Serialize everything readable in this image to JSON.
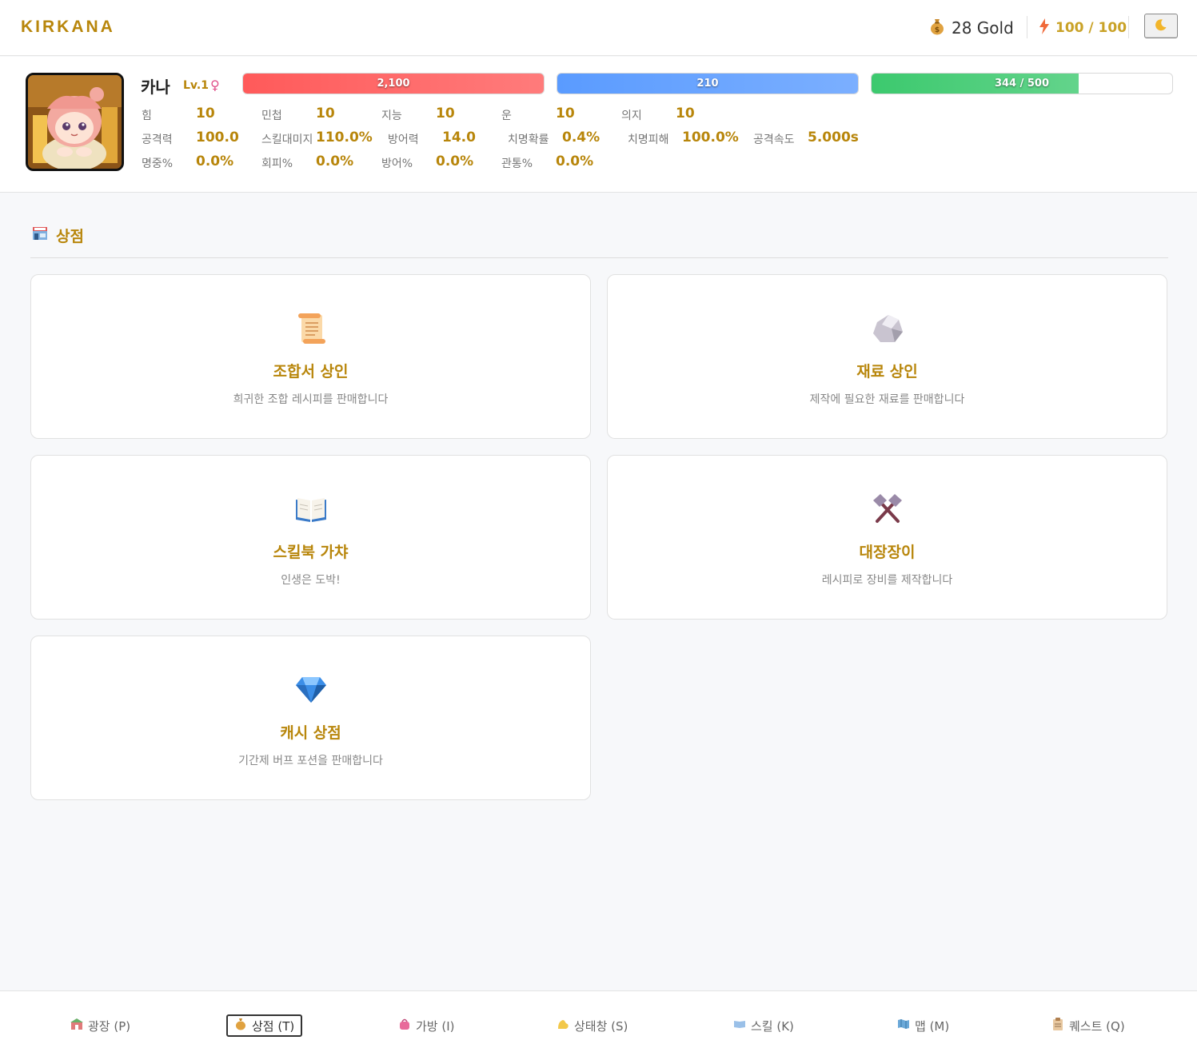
{
  "header": {
    "logo": "KIRKANA",
    "gold_icon": "money-bag-icon",
    "gold_text": "28 Gold",
    "energy_icon": "lightning-icon",
    "energy_text": "100 / 100",
    "theme_icon": "moon-icon"
  },
  "character": {
    "name": "카나",
    "level": "Lv.1",
    "gender": "♀",
    "hp": {
      "label": "2,100",
      "fraction": 1.0,
      "color": "#ff5a5a"
    },
    "mp": {
      "label": "210",
      "fraction": 1.0,
      "color": "#5a9bff"
    },
    "exp": {
      "label": "344 / 500",
      "fraction": 0.688,
      "color": "#3cc96e"
    },
    "stats": [
      [
        {
          "k": "힘",
          "v": "10"
        },
        {
          "k": "민첩",
          "v": "10"
        },
        {
          "k": "지능",
          "v": "10"
        },
        {
          "k": "운",
          "v": "10"
        },
        {
          "k": "의지",
          "v": "10"
        }
      ],
      [
        {
          "k": "공격력",
          "v": "100.0"
        },
        {
          "k": "스킬대미지",
          "v": "110.0%"
        },
        {
          "k": "방어력",
          "v": "14.0"
        },
        {
          "k": "치명확률",
          "v": "0.4%"
        },
        {
          "k": "치명피해",
          "v": "100.0%"
        },
        {
          "k": "공격속도",
          "v": "5.000s"
        }
      ],
      [
        {
          "k": "명중%",
          "v": "0.0%"
        },
        {
          "k": "회피%",
          "v": "0.0%"
        },
        {
          "k": "방어%",
          "v": "0.0%"
        },
        {
          "k": "관통%",
          "v": "0.0%"
        }
      ]
    ]
  },
  "shop": {
    "icon": "store-icon",
    "title": "상점",
    "cards": [
      {
        "icon": "scroll-icon",
        "title": "조합서 상인",
        "desc": "희귀한 조합 레시피를 판매합니다"
      },
      {
        "icon": "rock-icon",
        "title": "재료 상인",
        "desc": "제작에 필요한 재료를 판매합니다"
      },
      {
        "icon": "open-book-icon",
        "title": "스킬북 가챠",
        "desc": "인생은 도박!"
      },
      {
        "icon": "hammers-icon",
        "title": "대장장이",
        "desc": "레시피로 장비를 제작합니다"
      },
      {
        "icon": "gem-icon",
        "title": "캐시 상점",
        "desc": "기간제 버프 포션을 판매합니다"
      }
    ]
  },
  "nav": [
    {
      "icon": "plaza-icon",
      "label": "광장 (P)"
    },
    {
      "icon": "money-bag-icon",
      "label": "상점 (T)",
      "active": true
    },
    {
      "icon": "bag-icon",
      "label": "가방 (I)"
    },
    {
      "icon": "muscle-icon",
      "label": "상태창 (S)"
    },
    {
      "icon": "book-icon",
      "label": "스킬 (K)"
    },
    {
      "icon": "map-icon",
      "label": "맵 (M)"
    },
    {
      "icon": "clipboard-icon",
      "label": "퀘스트 (Q)"
    }
  ]
}
